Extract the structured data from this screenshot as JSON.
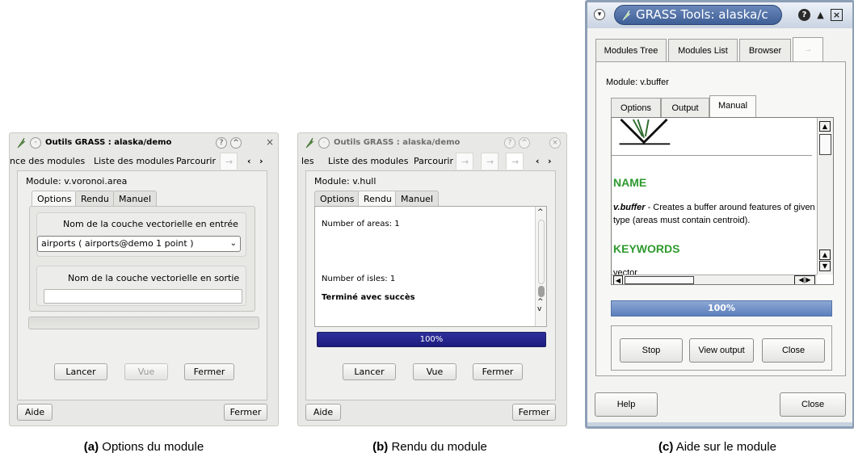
{
  "panel_a": {
    "window_title": "Outils GRASS : alaska/demo",
    "tabs": [
      "nce des modules",
      "Liste des modules",
      "Parcourir"
    ],
    "module_label": "Module: v.voronoi.area",
    "subtabs": [
      "Options",
      "Rendu",
      "Manuel"
    ],
    "input_group_label": "Nom de la couche vectorielle en entrée",
    "input_value": "airports ( airports@demo 1 point )",
    "output_group_label": "Nom de la couche vectorielle en sortie",
    "output_value": "",
    "buttons": {
      "run": "Lancer",
      "view": "Vue",
      "close": "Fermer"
    },
    "help": "Aide",
    "close": "Fermer"
  },
  "panel_b": {
    "window_title": "Outils GRASS : alaska/demo",
    "tabs": [
      "les",
      "Liste des modules",
      "Parcourir"
    ],
    "module_label": "Module: v.hull",
    "subtabs": [
      "Options",
      "Rendu",
      "Manuel"
    ],
    "output_lines": [
      "Number of areas: 1",
      "Number of isles: 1",
      "Terminé avec succès"
    ],
    "progress_text": "100%",
    "progress_value": 1.0,
    "buttons": {
      "run": "Lancer",
      "view": "Vue",
      "close": "Fermer"
    },
    "help": "Aide",
    "close": "Fermer"
  },
  "panel_c": {
    "window_title": "GRASS Tools: alaska/c",
    "tabs": [
      "Modules Tree",
      "Modules List",
      "Browser"
    ],
    "module_label": "Module: v.buffer",
    "subtabs": [
      "Options",
      "Output",
      "Manual"
    ],
    "doc": {
      "heading_name": "NAME",
      "module_name": "v.buffer",
      "description": " - Creates a buffer around features of given type (areas must contain centroid).",
      "heading_keywords": "KEYWORDS",
      "keyword": "vector"
    },
    "progress_text": "100%",
    "progress_value": 1.0,
    "buttons": {
      "stop": "Stop",
      "view_output": "View output",
      "close": "Close"
    },
    "help": "Help",
    "close": "Close"
  },
  "captions": {
    "a_bold": "(a)",
    "a_text": " Options du module",
    "b_bold": "(b)",
    "b_text": " Rendu du module",
    "c_bold": "(c)",
    "c_text": " Aide sur le module"
  },
  "icons": {
    "app": "grass-leaf-icon",
    "help": "question-mark-icon",
    "minimize": "chevron-up-icon",
    "close": "close-icon",
    "tab_arrow": "arrow-right-icon"
  },
  "colors": {
    "progress_b": "#1c1c7e",
    "progress_c": "#5c7fbc",
    "doc_heading": "#2e9a2e",
    "titlebar_c": "#3d5f97"
  }
}
